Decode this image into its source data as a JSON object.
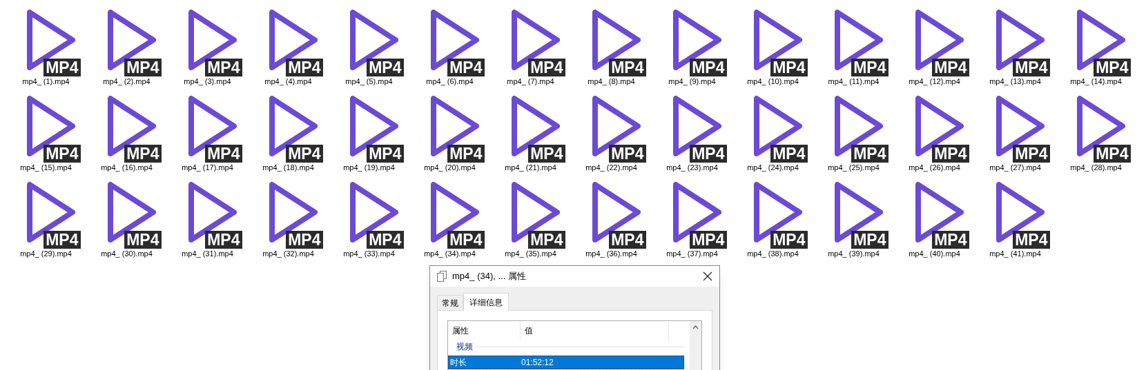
{
  "files": [
    {
      "name": "mp4_ (1).mp4",
      "badge": "MP4"
    },
    {
      "name": "mp4_ (2).mp4",
      "badge": "MP4"
    },
    {
      "name": "mp4_ (3).mp4",
      "badge": "MP4"
    },
    {
      "name": "mp4_ (4).mp4",
      "badge": "MP4"
    },
    {
      "name": "mp4_ (5).mp4",
      "badge": "MP4"
    },
    {
      "name": "mp4_ (6).mp4",
      "badge": "MP4"
    },
    {
      "name": "mp4_ (7).mp4",
      "badge": "MP4"
    },
    {
      "name": "mp4_ (8).mp4",
      "badge": "MP4"
    },
    {
      "name": "mp4_ (9).mp4",
      "badge": "MP4"
    },
    {
      "name": "mp4_ (10).mp4",
      "badge": "MP4"
    },
    {
      "name": "mp4_ (11).mp4",
      "badge": "MP4"
    },
    {
      "name": "mp4_ (12).mp4",
      "badge": "MP4"
    },
    {
      "name": "mp4_ (13).mp4",
      "badge": "MP4"
    },
    {
      "name": "mp4_ (14).mp4",
      "badge": "MP4"
    },
    {
      "name": "mp4_ (15).mp4",
      "badge": "MP4"
    },
    {
      "name": "mp4_ (16).mp4",
      "badge": "MP4"
    },
    {
      "name": "mp4_ (17).mp4",
      "badge": "MP4"
    },
    {
      "name": "mp4_ (18).mp4",
      "badge": "MP4"
    },
    {
      "name": "mp4_ (19).mp4",
      "badge": "MP4"
    },
    {
      "name": "mp4_ (20).mp4",
      "badge": "MP4"
    },
    {
      "name": "mp4_ (21).mp4",
      "badge": "MP4"
    },
    {
      "name": "mp4_ (22).mp4",
      "badge": "MP4"
    },
    {
      "name": "mp4_ (23).mp4",
      "badge": "MP4"
    },
    {
      "name": "mp4_ (24).mp4",
      "badge": "MP4"
    },
    {
      "name": "mp4_ (25).mp4",
      "badge": "MP4"
    },
    {
      "name": "mp4_ (26).mp4",
      "badge": "MP4"
    },
    {
      "name": "mp4_ (27).mp4",
      "badge": "MP4"
    },
    {
      "name": "mp4_ (28).mp4",
      "badge": "MP4"
    },
    {
      "name": "mp4_ (29).mp4",
      "badge": "MP4"
    },
    {
      "name": "mp4_ (30).mp4",
      "badge": "MP4"
    },
    {
      "name": "mp4_ (31).mp4",
      "badge": "MP4"
    },
    {
      "name": "mp4_ (32).mp4",
      "badge": "MP4"
    },
    {
      "name": "mp4_ (33).mp4",
      "badge": "MP4"
    },
    {
      "name": "mp4_ (34).mp4",
      "badge": "MP4"
    },
    {
      "name": "mp4_ (35).mp4",
      "badge": "MP4"
    },
    {
      "name": "mp4_ (36).mp4",
      "badge": "MP4"
    },
    {
      "name": "mp4_ (37).mp4",
      "badge": "MP4"
    },
    {
      "name": "mp4_ (38).mp4",
      "badge": "MP4"
    },
    {
      "name": "mp4_ (39).mp4",
      "badge": "MP4"
    },
    {
      "name": "mp4_ (40).mp4",
      "badge": "MP4"
    },
    {
      "name": "mp4_ (41).mp4",
      "badge": "MP4"
    }
  ],
  "dialog": {
    "title": "mp4_ (34), ... 属性",
    "tabs": [
      {
        "label": "常规",
        "selected": false
      },
      {
        "label": "详细信息",
        "selected": true
      }
    ],
    "columns": [
      "属性",
      "值"
    ],
    "group": "视频",
    "rows": [
      {
        "name": "时长",
        "value": "01:52:12",
        "selected": true
      }
    ]
  }
}
